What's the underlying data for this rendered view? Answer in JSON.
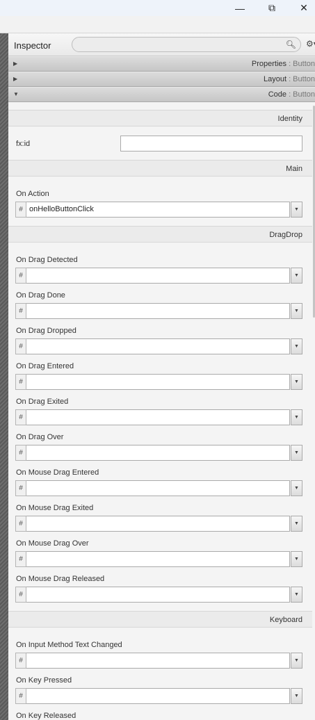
{
  "window": {
    "min_glyph": "—",
    "max_glyph": "⧉",
    "close_glyph": "✕"
  },
  "inspector": {
    "title": "Inspector",
    "search_placeholder": ""
  },
  "accordion": [
    {
      "label": "Properties",
      "sub": " : Button",
      "expanded": false
    },
    {
      "label": "Layout",
      "sub": " : Button",
      "expanded": false
    },
    {
      "label": "Code",
      "sub": " : Button",
      "expanded": true
    }
  ],
  "sections": {
    "identity": {
      "title": "Identity",
      "fxid_label": "fx:id",
      "fxid_value": ""
    },
    "main": {
      "title": "Main",
      "on_action_label": "On Action",
      "on_action_value": "onHelloButtonClick"
    },
    "dragdrop": {
      "title": "DragDrop",
      "fields": [
        {
          "label": "On Drag Detected",
          "value": ""
        },
        {
          "label": "On Drag Done",
          "value": ""
        },
        {
          "label": "On Drag Dropped",
          "value": ""
        },
        {
          "label": "On Drag Entered",
          "value": ""
        },
        {
          "label": "On Drag Exited",
          "value": ""
        },
        {
          "label": "On Drag Over",
          "value": ""
        },
        {
          "label": "On Mouse Drag Entered",
          "value": ""
        },
        {
          "label": "On Mouse Drag Exited",
          "value": ""
        },
        {
          "label": "On Mouse Drag Over",
          "value": ""
        },
        {
          "label": "On Mouse Drag Released",
          "value": ""
        }
      ]
    },
    "keyboard": {
      "title": "Keyboard",
      "fields": [
        {
          "label": "On Input Method Text Changed",
          "value": ""
        },
        {
          "label": "On Key Pressed",
          "value": ""
        },
        {
          "label": "On Key Released",
          "value": ""
        }
      ]
    }
  },
  "combo": {
    "hash": "#",
    "arrow": "▼"
  },
  "icons": {
    "search": "search-icon",
    "gear": "gear-icon",
    "collapsed": "▶",
    "expanded": "▼"
  }
}
